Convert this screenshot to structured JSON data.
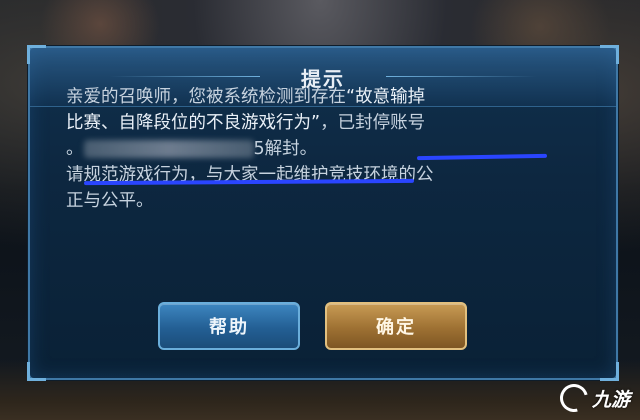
{
  "dialog": {
    "title": "提示",
    "message": {
      "line1_prefix": "亲爱的召唤师，您被系统检测到存在",
      "line1_highlight": "“故意输掉",
      "line2_highlight": "比赛、自降段位的不良游戏行为”",
      "line2_suffix": "，已封停账号",
      "line3_prefix": "。",
      "line3_suffix": "5解封。",
      "line4": "请规范游戏行为，与大家一起维护竞技环境的公",
      "line5": "正与公平。"
    },
    "buttons": {
      "help_label": "帮助",
      "confirm_label": "确定"
    },
    "annotation_color": "#2a45ff"
  },
  "watermark": {
    "text": "九游"
  }
}
